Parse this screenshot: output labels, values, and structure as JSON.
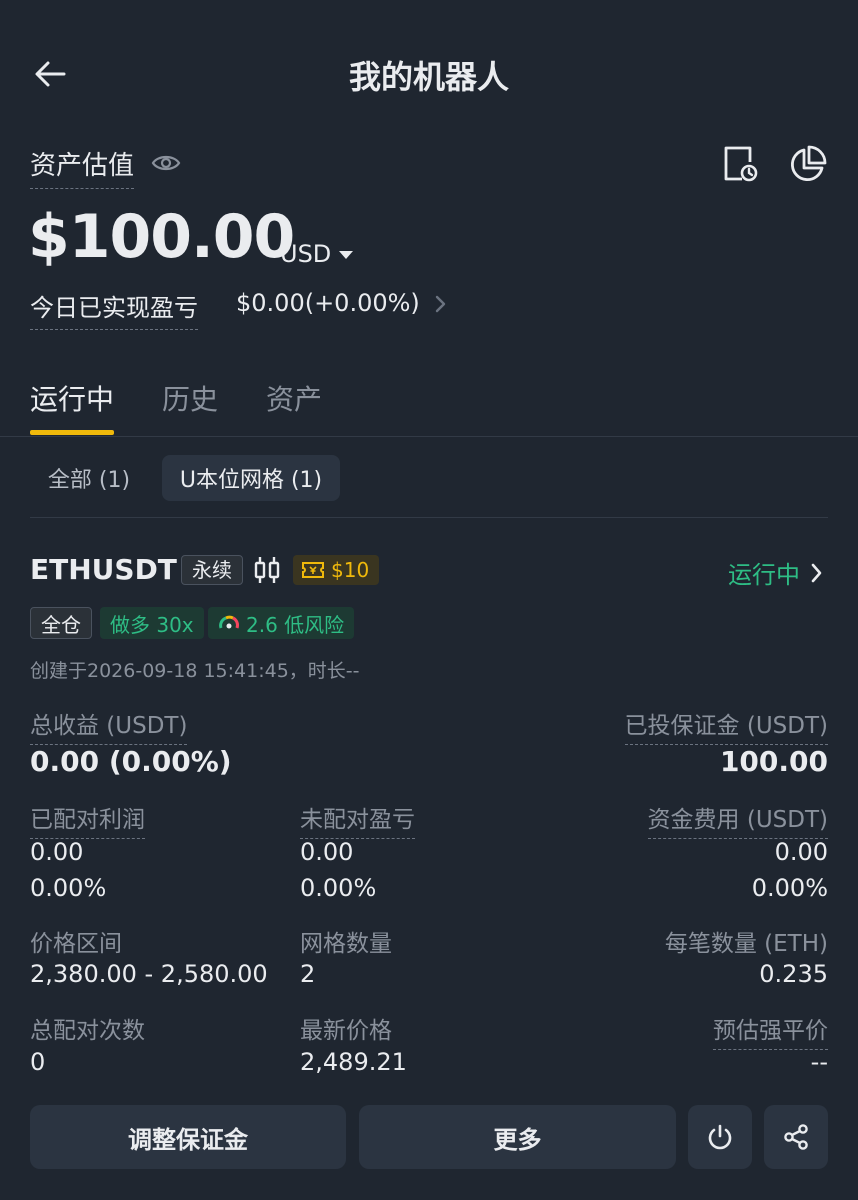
{
  "header": {
    "title": "我的机器人",
    "back_icon": "arrow-left-icon"
  },
  "assets": {
    "label": "资产估值",
    "value": "$100.00",
    "currency": "USD",
    "pnl_label": "今日已实现盈亏",
    "pnl_value": "$0.00(+0.00%)"
  },
  "tabs": [
    {
      "label": "运行中",
      "active": true
    },
    {
      "label": "历史",
      "active": false
    },
    {
      "label": "资产",
      "active": false
    }
  ],
  "filters": [
    {
      "label": "全部 (1)",
      "selected": false
    },
    {
      "label": "U本位网格 (1)",
      "selected": true
    }
  ],
  "bot": {
    "symbol": "ETHUSDT",
    "type_tag": "永续",
    "coupon": "$10",
    "status": "运行中",
    "tags": {
      "margin_mode": "全仓",
      "direction": "做多 30x",
      "risk": "2.6 低风险"
    },
    "created": "创建于2026-09-18 15:41:45，时长--",
    "total_profit_label": "总收益 (USDT)",
    "total_profit_value": "0.00 (0.00%)",
    "margin_label": "已投保证金 (USDT)",
    "margin_value": "100.00",
    "matched_label": "已配对利润",
    "matched_value": "0.00",
    "matched_pct": "0.00%",
    "unmatched_label": "未配对盈亏",
    "unmatched_value": "0.00",
    "unmatched_pct": "0.00%",
    "funding_label": "资金费用 (USDT)",
    "funding_value": "0.00",
    "funding_pct": "0.00%",
    "range_label": "价格区间",
    "range_value": "2,380.00 - 2,580.00",
    "grids_label": "网格数量",
    "grids_value": "2",
    "qty_label": "每笔数量 (ETH)",
    "qty_value": "0.235",
    "match_count_label": "总配对次数",
    "match_count_value": "0",
    "last_price_label": "最新价格",
    "last_price_value": "2,489.21",
    "liq_label": "预估强平价",
    "liq_value": "--"
  },
  "actions": {
    "adjust_margin": "调整保证金",
    "more": "更多"
  },
  "colors": {
    "accent": "#f0b90b",
    "positive": "#2ebd85",
    "background": "#1f2630"
  }
}
